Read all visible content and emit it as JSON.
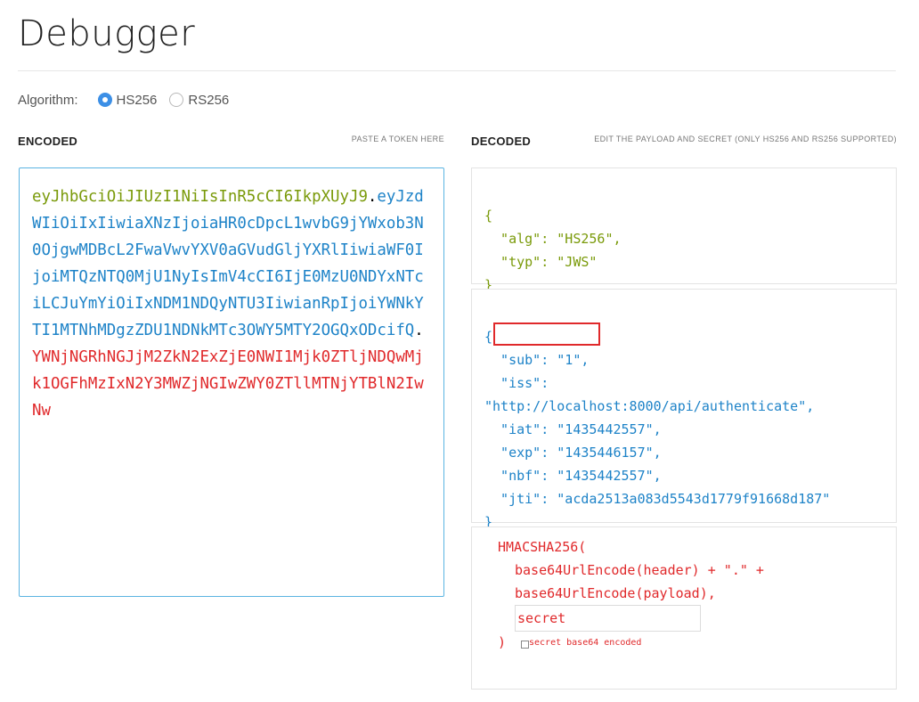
{
  "page": {
    "title": "Debugger"
  },
  "algorithm": {
    "label": "Algorithm:",
    "options": [
      {
        "label": "HS256",
        "selected": true
      },
      {
        "label": "RS256",
        "selected": false
      }
    ]
  },
  "encoded": {
    "heading": "ENCODED",
    "hint": "PASTE A TOKEN HERE",
    "token": {
      "header": "eyJhbGciOiJIUzI1NiIsInR5cCI6IkpXUyJ9",
      "payload": "eyJzdWIiOiIxIiwiaXNzIjoiaHR0cDpcL1wvbG9jYWxob3N0OjgwMDBcL2FwaVwvYXV0aGVudGljYXRlIiwiaWF0IjoiMTQzNTQ0MjU1NyIsImV4cCI6IjE0MzU0NDYxNTciLCJuYmYiOiIxNDM1NDQyNTU3IiwianRpIjoiYWNkYTI1MTNhMDgzZDU1NDNkMTc3OWY5MTY2OGQxODcifQ",
      "signature": "YWNjNGRhNGJjM2ZkN2ExZjE0NWI1Mjk0ZTljNDQwMjk1OGFhMzIxN2Y3MWZjNGIwZWY0ZTllMTNjYTBlN2IwNw",
      "separator": "."
    }
  },
  "decoded": {
    "heading": "DECODED",
    "hint": "EDIT THE PAYLOAD AND SECRET (ONLY HS256 AND RS256 SUPPORTED)",
    "header_lines": [
      "{",
      "  \"alg\": \"HS256\",",
      "  \"typ\": \"JWS\"",
      "}"
    ],
    "payload_lines": [
      "{",
      "  \"sub\": \"1\",",
      "  \"iss\":",
      "\"http://localhost:8000/api/authenticate\",",
      "  \"iat\": \"1435442557\",",
      "  \"exp\": \"1435446157\",",
      "  \"nbf\": \"1435442557\",",
      "  \"jti\": \"acda2513a083d5543d1779f91668d187\"",
      "}"
    ],
    "verify": {
      "func": "HMACSHA256(",
      "line1": "base64UrlEncode(header) + \".\" +",
      "line2": "base64UrlEncode(payload),",
      "secret_value": "secret",
      "close": ")",
      "checkbox_label": "secret base64 encoded",
      "checkbox_checked": false
    }
  },
  "colors": {
    "header": "#7a9a0a",
    "payload": "#1e83c8",
    "signature": "#e0292b",
    "accent": "#3c8fe6"
  }
}
